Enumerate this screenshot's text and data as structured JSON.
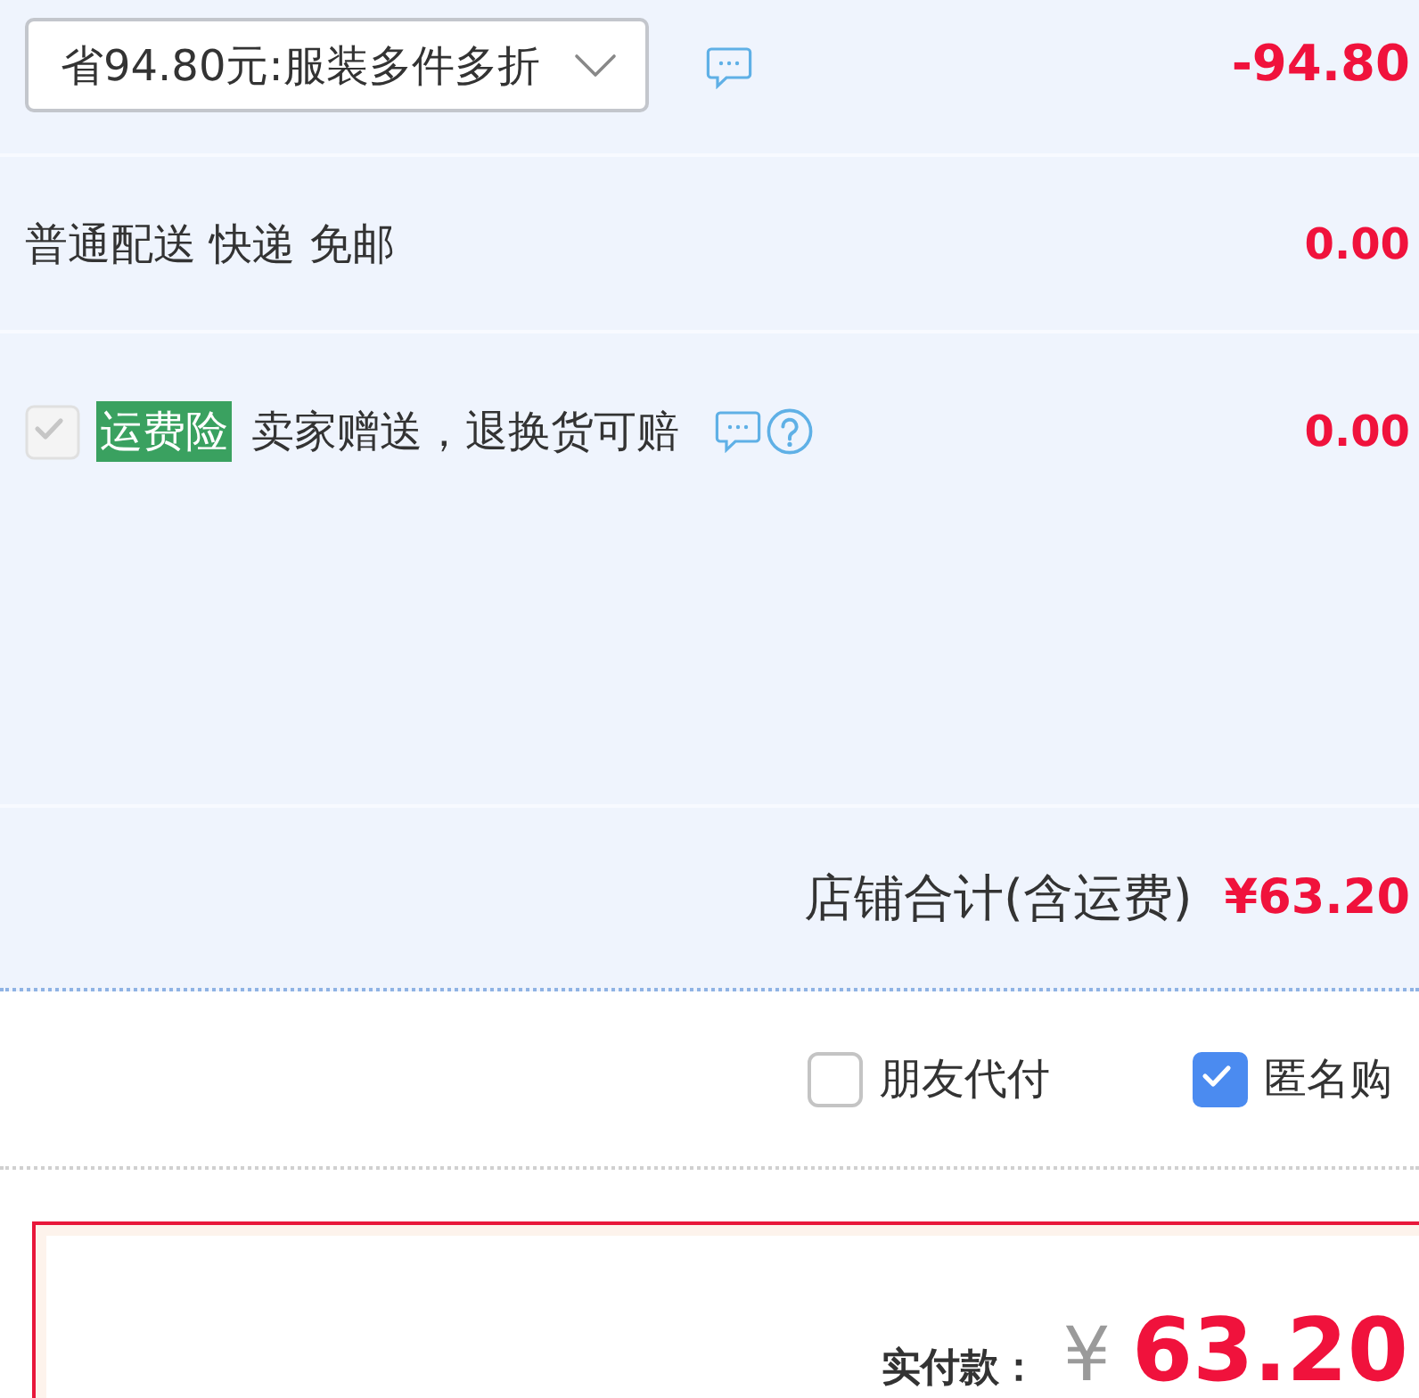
{
  "discount": {
    "dropdown": {
      "value": "省94.80元:服装多件多折"
    },
    "amount": "-94.80"
  },
  "shipping": {
    "label": "普通配送 快递 免邮",
    "amount": "0.00"
  },
  "insurance": {
    "checked": true,
    "disabled": true,
    "badge": "运费险",
    "text": "卖家赠送，退换货可赔",
    "amount": "0.00"
  },
  "shop_total": {
    "label": "店铺合计(含运费)",
    "amount": "¥63.20"
  },
  "options": [
    {
      "label": "朋友代付",
      "checked": false
    },
    {
      "label": "匿名购",
      "checked": true
    }
  ],
  "payment": {
    "label": "实付款：",
    "currency": "¥",
    "amount": "63.20"
  }
}
